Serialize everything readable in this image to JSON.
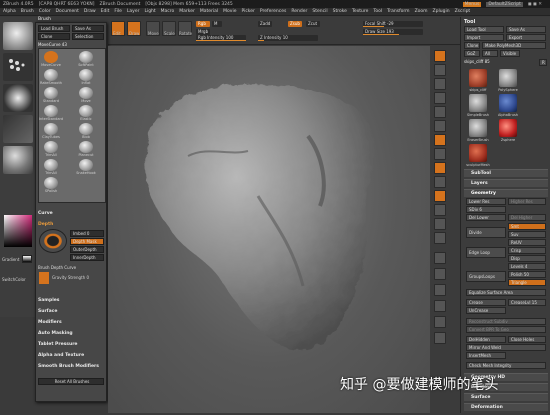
{
  "titlebar": {
    "items": [
      "ZBrush 4.0R5",
      "[CAP8 QHRT 6E63 YOKN]",
      "ZBrush Document",
      "[Objs 8298] Mem 659+113 Frees 3245"
    ],
    "buttons": [
      "Menus",
      "DefaultZScript"
    ]
  },
  "menubar": [
    "Alpha",
    "Brush",
    "Color",
    "Document",
    "Draw",
    "Edit",
    "File",
    "Layer",
    "Light",
    "Macro",
    "Marker",
    "Material",
    "Movie",
    "Picker",
    "Preferences",
    "Render",
    "Stencil",
    "Stroke",
    "Texture",
    "Tool",
    "Transform",
    "Zoom",
    "Zplugin",
    "Zscript"
  ],
  "toolbar": {
    "buttons": [
      "Edit",
      "Draw",
      "Move",
      "Scale",
      "Rotate"
    ],
    "rgb": "Rgb",
    "m": "M",
    "mrgb": "Mrgb",
    "rgb_intensity": "Rgb Intensity 100",
    "zadd": "Zadd",
    "zsub": "Zsub",
    "zcut": "Zcut",
    "z_intensity": "Z Intensity 10",
    "focal_shift": "Focal Shift -29",
    "draw_size": "Draw Size 193"
  },
  "brush_popup": {
    "title": "Brush",
    "load": "Load Brush",
    "save": "Save As",
    "clone": "Clone",
    "selection": "Selection",
    "current": "MoveCurve 43",
    "brushes": [
      "MoveCurve",
      "SoftPaint",
      "RakeSmooth",
      "Inflat",
      "Standard",
      "Move",
      "InterStandard",
      "Elastic",
      "ClayTubes",
      "Blob",
      "TrimAll",
      "Planecut",
      "TrimAll",
      "SnakeHook",
      "SPolish"
    ],
    "curve": "Curve",
    "depth": "Depth",
    "imbed": "Imbed 0",
    "depth_mask": "Depth Mask",
    "outer_depth": "OuterDepth",
    "inner_depth": "InnerDepth",
    "brush_depth_curve": "Brush Depth Curve",
    "gravity": "Gravity Strength 0",
    "sections": [
      "Samples",
      "Surface",
      "Modifiers",
      "Auto Masking",
      "Tablet Pressure",
      "Alpha and Texture",
      "Smooth Brush Modifiers"
    ],
    "reset": "Reset All Brushes"
  },
  "left": {
    "gradient": "Gradient",
    "switch": "SwitchColor"
  },
  "right_shelf": [
    "BPR",
    "SPix",
    "Scroll",
    "Zoom",
    "Actual",
    "AAHalf",
    "Persp",
    "Floor",
    "Local",
    "LSym",
    "Frame",
    "Move",
    "Scale",
    "Rotate",
    "Transp",
    "Dynamic",
    "Solo",
    "Ghost",
    "Xpose"
  ],
  "tool_panel": {
    "title": "Tool",
    "load": "Load Tool",
    "save": "Save As",
    "import": "Import",
    "export": "Export",
    "clone": "Clone",
    "make_poly": "Make PolyMesh3D",
    "go_z": "GoZ",
    "all": "All",
    "visible": "Visible",
    "current": "skips_cliff 85",
    "r": "R",
    "tools": [
      "skips_cliff",
      "PolySphere",
      "SimpleBrush",
      "AlphaBrush",
      "EraserBrush",
      "Zsphere",
      "sculpturMesh",
      "PolyMesh3D"
    ],
    "subtool": "SubTool",
    "layers": "Layers",
    "geometry": "Geometry",
    "lower_res": "Lower Res",
    "higher_res": "Higher Res",
    "sdiv": "SDiv 6",
    "del_lower": "Del Lower",
    "del_higher": "Del Higher",
    "divide": "Divide",
    "smt": "Smt",
    "suv": "Suv",
    "reuv": "ReUV",
    "edge_loop": "Edge Loop",
    "crisp": "Crisp",
    "disp": "Disp",
    "levels": "Levels 4",
    "group_loops": "GroupsLoops",
    "polish": "Polish 50",
    "triangle": "Triangle",
    "equalize": "Equalize Surface Area",
    "crease": "Crease",
    "crease_lvl": "CreaseLvl 15",
    "uncrease": "UnCrease",
    "reconstruct": "Reconstruct Subdiv",
    "convert_bpr": "Convert BPR To Geo",
    "del_hidden": "DelHidden",
    "close_holes": "Close Holes",
    "mirror_weld": "Mirror And Weld",
    "insert_mesh": "InsertMesh",
    "check_integrity": "Check Mesh Integrity",
    "more_sections": [
      "Geometry HD",
      "Preview",
      "Surface",
      "Deformation"
    ]
  },
  "watermark": "知乎 @要做建模师的笔头"
}
